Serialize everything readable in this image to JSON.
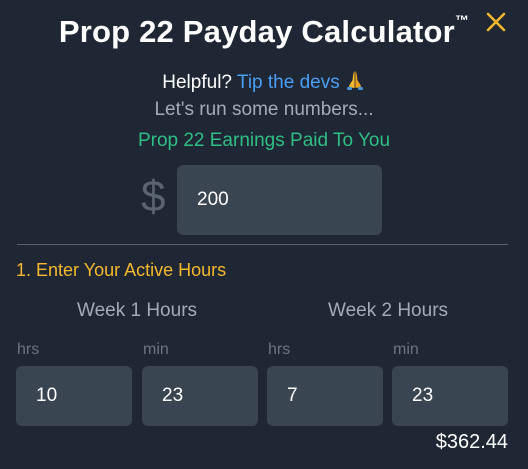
{
  "header": {
    "title": "Prop 22 Payday Calculator",
    "trademark": "™",
    "close_icon": "close-icon",
    "accent_color": "#f5b82e"
  },
  "tip": {
    "prefix": "Helpful? ",
    "link_label": "Tip the devs",
    "emoji": "🙏",
    "link_color": "#4a9ef5"
  },
  "subtitle": "Let's run some numbers...",
  "earnings": {
    "label": "Prop 22 Earnings Paid To You",
    "label_color": "#2fbf86",
    "currency_symbol": "$",
    "value": "200"
  },
  "hours": {
    "section_title": "1. Enter Your Active Hours",
    "week1": {
      "title": "Week 1 Hours",
      "hrs_label": "hrs",
      "min_label": "min",
      "hrs_value": "10",
      "min_value": "23"
    },
    "week2": {
      "title": "Week 2 Hours",
      "hrs_label": "hrs",
      "min_label": "min",
      "hrs_value": "7",
      "min_value": "23"
    }
  },
  "total": "$362.44"
}
